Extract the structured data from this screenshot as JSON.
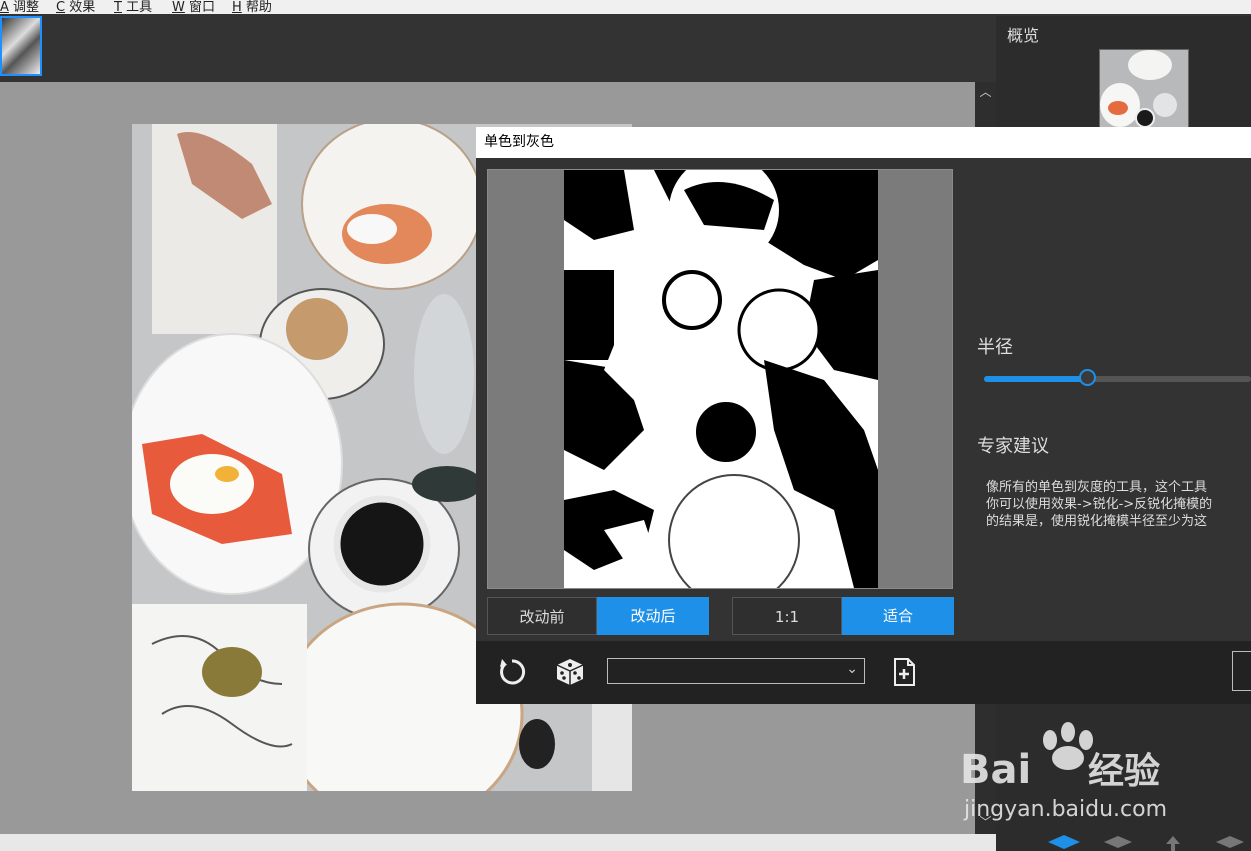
{
  "menu": [
    {
      "key": "A",
      "label": "调整"
    },
    {
      "key": "C",
      "label": "效果"
    },
    {
      "key": "T",
      "label": "工具"
    },
    {
      "key": "W",
      "label": "窗口"
    },
    {
      "key": "H",
      "label": "帮助"
    }
  ],
  "overview": {
    "title": "概览"
  },
  "dialog": {
    "title": "单色到灰色",
    "view_toggle": {
      "before": "改动前",
      "after": "改动后",
      "selected": "after"
    },
    "zoom_toggle": {
      "one_to_one": "1:1",
      "fit": "适合",
      "selected": "fit"
    },
    "radius_label": "半径",
    "radius_slider_fraction": 0.39,
    "advice_title": "专家建议",
    "advice_lines": [
      "像所有的单色到灰度的工具，这个工具",
      "你可以使用效果->锐化->反锐化掩模的",
      "的结果是，使用锐化掩模半径至少为这"
    ],
    "toolbar": {
      "reset_icon": "reset-icon",
      "random_icon": "dice-icon",
      "preset_value": "",
      "new_preset_icon": "new-file-icon"
    }
  },
  "watermark": {
    "brand": "Bai",
    "brand2": "du",
    "text": "经验",
    "url": "jingyan.baidu.com"
  },
  "colors": {
    "accent": "#1e90e8",
    "panel": "#333333",
    "canvas": "#999999"
  }
}
